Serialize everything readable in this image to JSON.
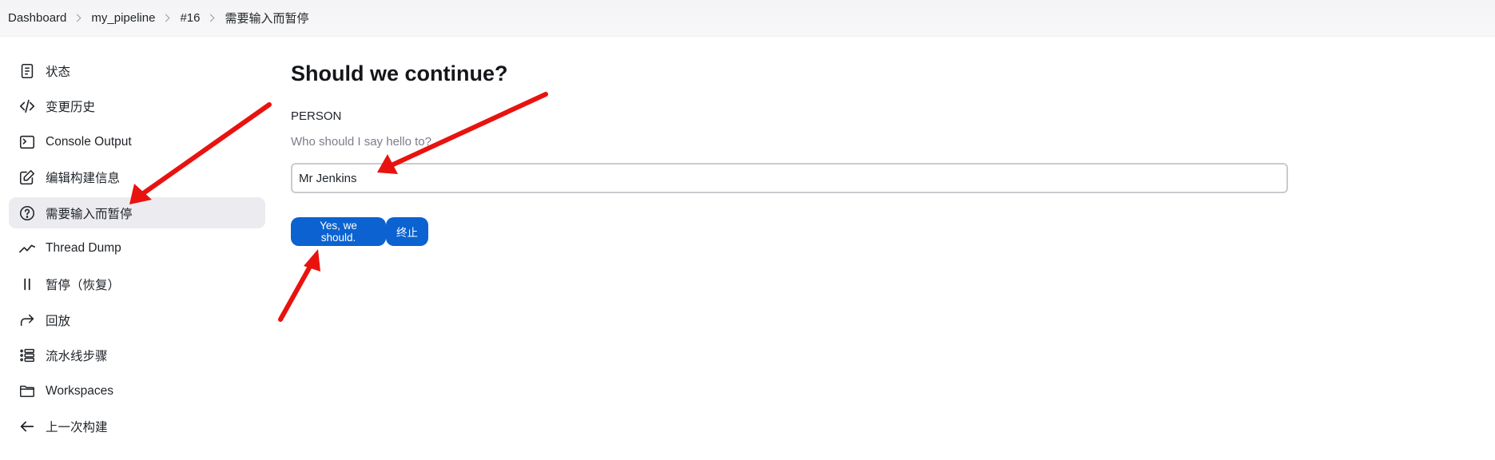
{
  "breadcrumb": {
    "items": [
      "Dashboard",
      "my_pipeline",
      "#16",
      "需要输入而暂停"
    ]
  },
  "sidebar": {
    "items": [
      {
        "label": "状态",
        "icon": "document-icon"
      },
      {
        "label": "变更历史",
        "icon": "code-icon"
      },
      {
        "label": "Console Output",
        "icon": "terminal-icon"
      },
      {
        "label": "编辑构建信息",
        "icon": "edit-icon"
      },
      {
        "label": "需要输入而暂停",
        "icon": "question-circle-icon",
        "active": true
      },
      {
        "label": "Thread Dump",
        "icon": "trend-line-icon"
      },
      {
        "label": "暂停（恢复）",
        "icon": "pause-icon"
      },
      {
        "label": "回放",
        "icon": "replay-arrow-icon"
      },
      {
        "label": "流水线步骤",
        "icon": "list-steps-icon"
      },
      {
        "label": "Workspaces",
        "icon": "folder-icon"
      },
      {
        "label": "上一次构建",
        "icon": "arrow-left-icon"
      }
    ]
  },
  "main": {
    "title": "Should we continue?",
    "parameter": {
      "name": "PERSON",
      "description": "Who should I say hello to?",
      "value": "Mr Jenkins"
    },
    "buttons": {
      "proceed": "Yes, we should.",
      "abort": "终止"
    }
  },
  "colors": {
    "accent": "#0b62d0",
    "active_bg": "#ececf0",
    "annotation_arrow": "#e8130f"
  }
}
